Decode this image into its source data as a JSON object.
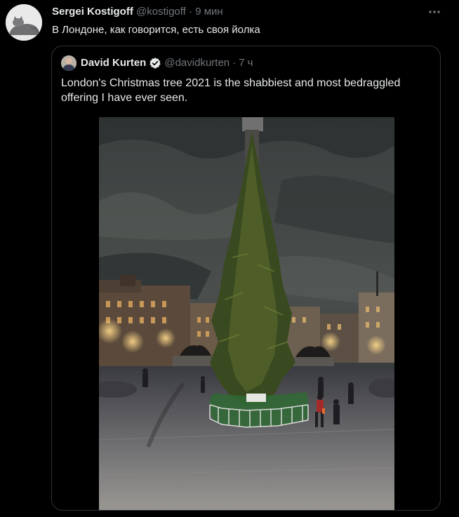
{
  "tweet": {
    "author_name": "Sergei Kostigoff",
    "author_handle": "@kostigoff",
    "separator": "·",
    "time": "9 мин",
    "text": "В Лондоне, как говорится, есть своя йолка"
  },
  "quoted": {
    "author_name": "David Kurten",
    "author_handle": "@davidkurten",
    "separator": "·",
    "time": "7 ч",
    "text": "London's Christmas tree 2021 is the shabbiest and most bedraggled offering I have ever seen.",
    "verified": true
  },
  "colors": {
    "background": "#000000",
    "text": "#e7e9ea",
    "muted": "#71767b",
    "border": "#2f3336"
  },
  "icons": {
    "more": "more-dots-icon",
    "verified": "verified-badge-icon"
  }
}
